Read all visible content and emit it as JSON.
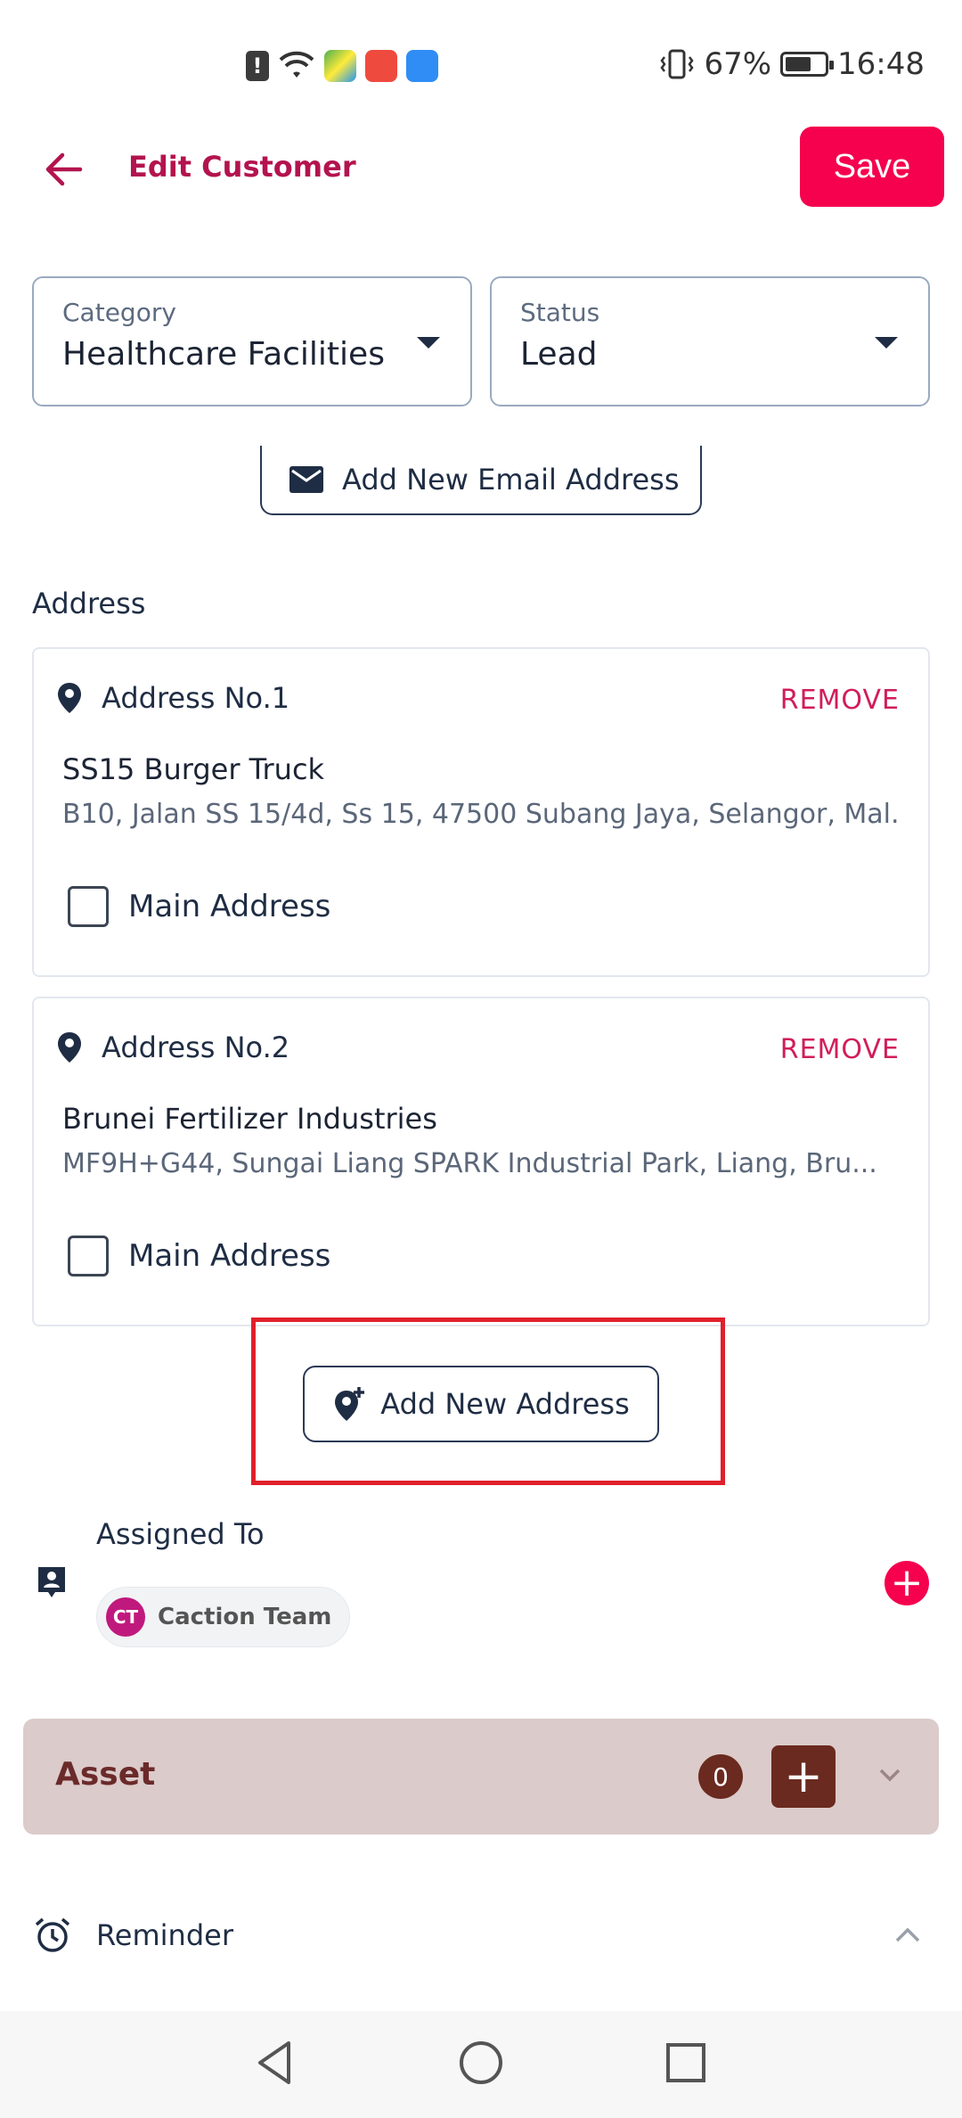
{
  "status_bar": {
    "battery_percent": "67%",
    "time": "16:48",
    "alert_glyph": "!",
    "app_icons": [
      "maps-app-icon",
      "huawei-appgallery-icon",
      "cloud-app-icon"
    ]
  },
  "header": {
    "title": "Edit Customer",
    "save_label": "Save"
  },
  "category": {
    "label": "Category",
    "value": "Healthcare Facilities"
  },
  "status": {
    "label": "Status",
    "value": "Lead"
  },
  "email": {
    "add_label": "Add New Email Address"
  },
  "address_section": {
    "title": "Address",
    "items": [
      {
        "heading": "Address No.1",
        "remove_label": "REMOVE",
        "name": "SS15 Burger Truck",
        "line": "B10, Jalan SS 15/4d, Ss 15, 47500 Subang Jaya, Selangor, Mal...",
        "main_label": "Main Address"
      },
      {
        "heading": "Address No.2",
        "remove_label": "REMOVE",
        "name": "Brunei Fertilizer Industries",
        "line": "MF9H+G44, Sungai Liang SPARK Industrial Park, Liang, Bru...",
        "main_label": "Main Address"
      }
    ],
    "add_label": "Add New Address"
  },
  "assigned": {
    "label": "Assigned To",
    "chip_initials": "CT",
    "chip_name": "Caction Team"
  },
  "asset": {
    "title": "Asset",
    "count": "0",
    "add_glyph": "+"
  },
  "reminder": {
    "label": "Reminder"
  },
  "colors": {
    "accent": "#f5014e",
    "title": "#b3134e",
    "text": "#1f2d44",
    "asset_bg": "#dccbcb",
    "asset_dark": "#6b2a1f",
    "highlight": "#e0202b"
  }
}
